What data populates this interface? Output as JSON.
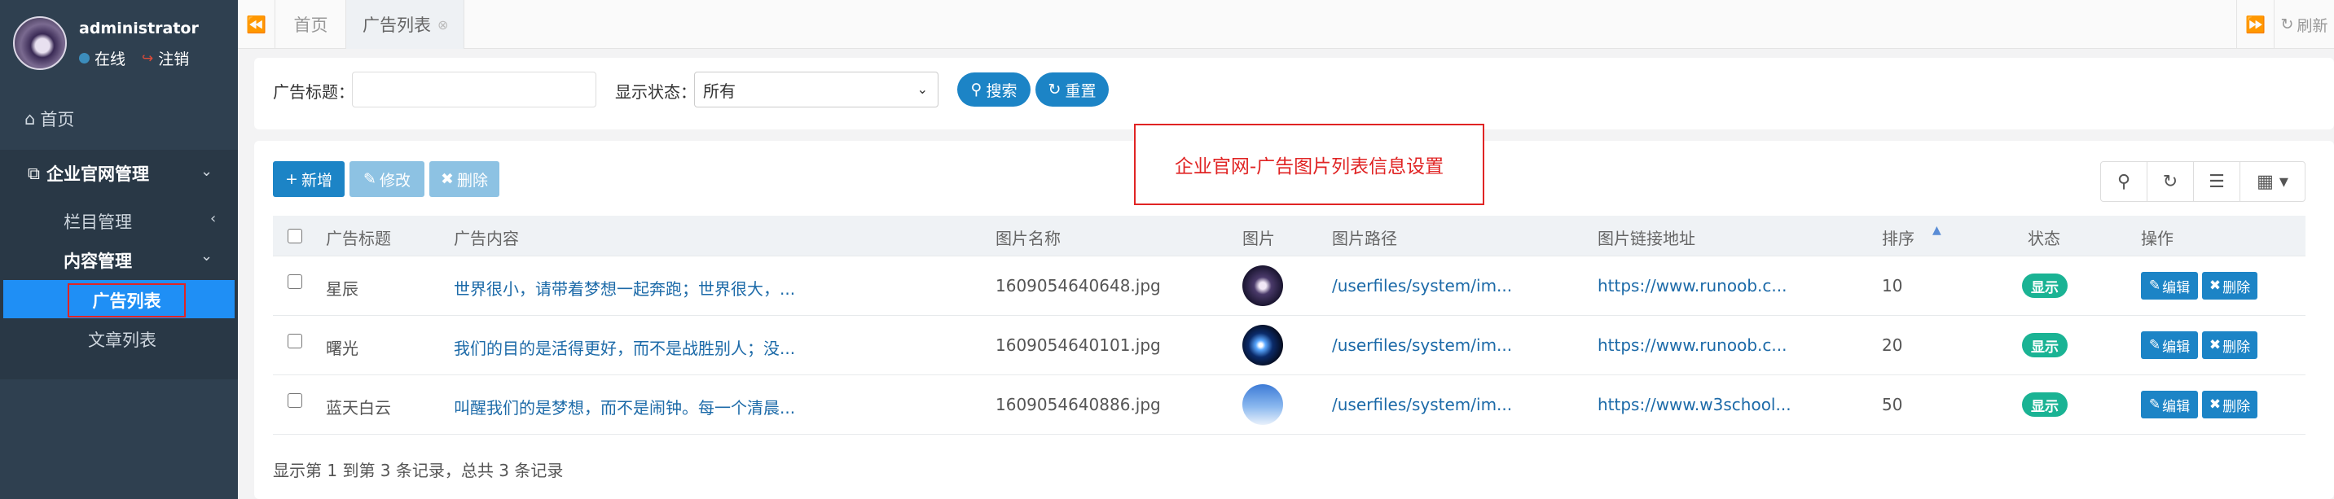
{
  "user": {
    "name": "administrator",
    "status": "在线",
    "logout": "注销"
  },
  "nav": {
    "home": "首页",
    "group": "企业官网管理",
    "column_mgmt": "栏目管理",
    "content_mgmt": "内容管理",
    "ad_list": "广告列表",
    "article_list": "文章列表"
  },
  "tabs": {
    "home": "首页",
    "active": "广告列表",
    "refresh": "刷新"
  },
  "search": {
    "title_label": "广告标题：",
    "title_value": "",
    "status_label": "显示状态：",
    "status_selected": "所有",
    "search_btn": "搜索",
    "reset_btn": "重置"
  },
  "toolbar": {
    "add": "新增",
    "edit": "修改",
    "delete": "删除"
  },
  "page_title": "企业官网-广告图片列表信息设置",
  "table": {
    "headers": [
      "广告标题",
      "广告内容",
      "图片名称",
      "图片",
      "图片路径",
      "图片链接地址",
      "排序",
      "状态",
      "操作"
    ],
    "rows": [
      {
        "title": "星辰",
        "content": "世界很小，请带着梦想一起奔跑；世界很大，...",
        "image_name": "1609054640648.jpg",
        "path": "/userfiles/system/im...",
        "link": "https://www.runoob.c...",
        "sort": "10",
        "status": "显示"
      },
      {
        "title": "曙光",
        "content": "我们的目的是活得更好，而不是战胜别人；没...",
        "image_name": "1609054640101.jpg",
        "path": "/userfiles/system/im...",
        "link": "https://www.runoob.c...",
        "sort": "20",
        "status": "显示"
      },
      {
        "title": "蓝天白云",
        "content": "叫醒我们的是梦想，而不是闹钟。每一个清晨...",
        "image_name": "1609054640886.jpg",
        "path": "/userfiles/system/im...",
        "link": "https://www.w3school...",
        "sort": "50",
        "status": "显示"
      }
    ],
    "edit_label": "编辑",
    "delete_label": "删除"
  },
  "footer": "显示第 1 到第 3 条记录，总共 3 条记录"
}
